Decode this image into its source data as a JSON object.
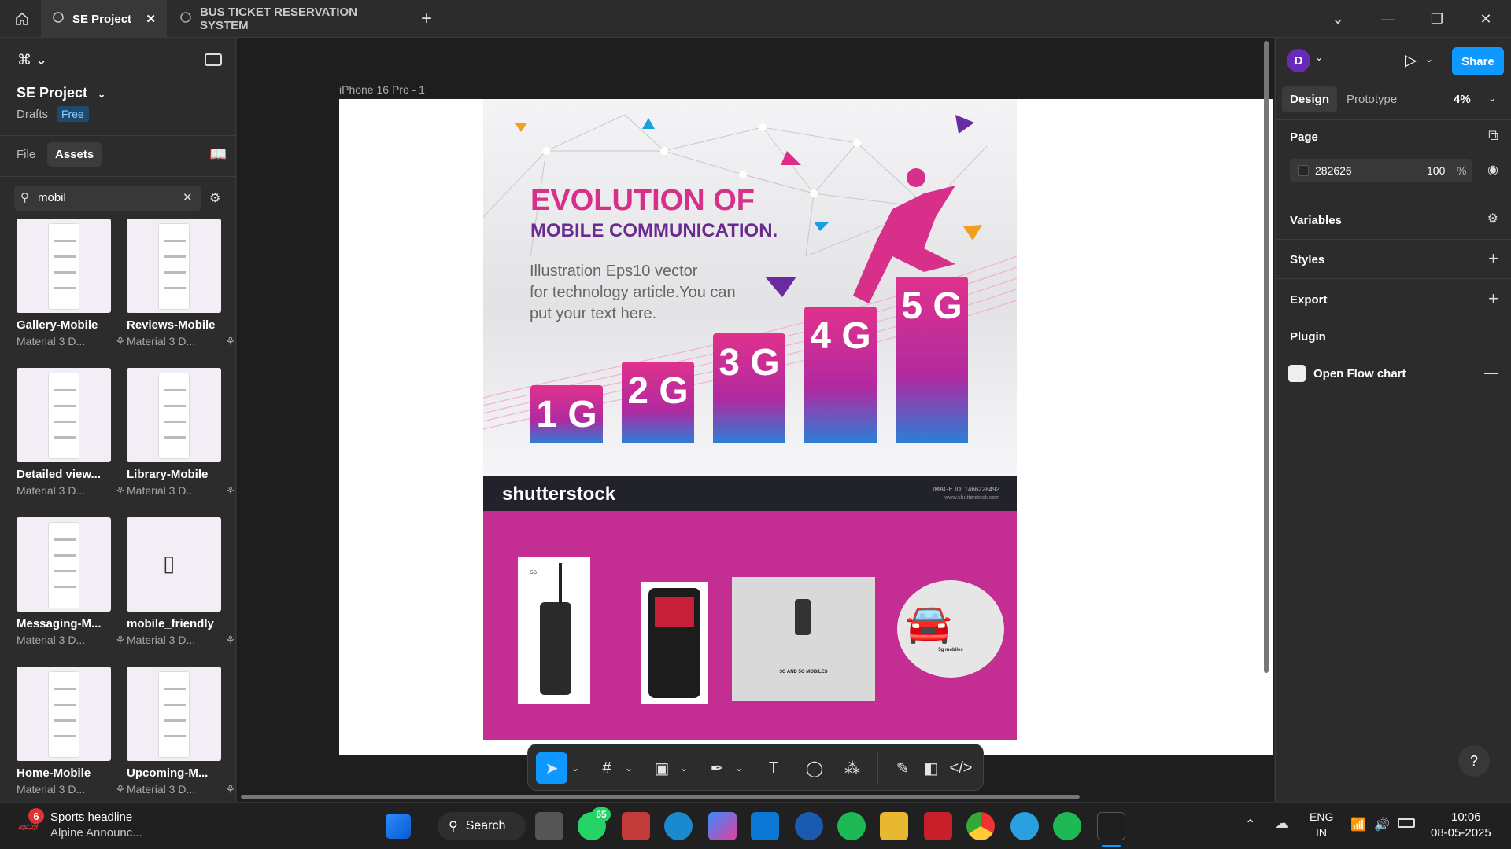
{
  "titlebar": {
    "tabs": [
      {
        "label": "SE Project",
        "active": true
      },
      {
        "label": "BUS TICKET RESERVATION SYSTEM",
        "active": false
      }
    ],
    "icons": [
      "home-icon",
      "figma-tab-icon",
      "close-icon",
      "add-tab-icon",
      "chevron-down-icon",
      "minimize-icon",
      "restore-icon",
      "close-window-icon"
    ]
  },
  "left": {
    "project_name": "SE Project",
    "drafts": "Drafts",
    "plan_badge": "Free",
    "tabs": {
      "file": "File",
      "assets": "Assets"
    },
    "search": {
      "value": "mobil",
      "placeholder": "Search"
    },
    "assets": [
      {
        "name": "Gallery-Mobile",
        "sub": "Material 3 D..."
      },
      {
        "name": "Reviews-Mobile",
        "sub": "Material 3 D..."
      },
      {
        "name": "Detailed view...",
        "sub": "Material 3 D..."
      },
      {
        "name": "Library-Mobile",
        "sub": "Material 3 D..."
      },
      {
        "name": "Messaging-M...",
        "sub": "Material 3 D..."
      },
      {
        "name": "mobile_friendly",
        "sub": "Material 3 D..."
      },
      {
        "name": "Home-Mobile",
        "sub": "Material 3 D..."
      },
      {
        "name": "Upcoming-M...",
        "sub": "Material 3 D..."
      }
    ]
  },
  "canvas": {
    "frame_label": "iPhone 16 Pro - 1",
    "poster": {
      "title1": "EVOLUTION OF",
      "title2": "MOBILE COMMUNICATION.",
      "body1": "Illustration Eps10 vector",
      "body2": "for technology article.You can",
      "body3": "put your text here.",
      "bars": [
        "1 G",
        "2 G",
        "3 G",
        "4 G",
        "5 G"
      ]
    },
    "shutterstock": {
      "logo": "shutterstock",
      "image_id": "IMAGE ID: 1466228492",
      "url": "www.shutterstock.com"
    },
    "cards": {
      "card1_label": "5G",
      "card3_label": "3G AND 5G MOBILES",
      "card4_label": "5g mobiles"
    }
  },
  "right": {
    "avatar": "D",
    "tabs": {
      "design": "Design",
      "prototype": "Prototype"
    },
    "zoom": "4%",
    "page_label": "Page",
    "page_color": "282626",
    "page_opacity": "100",
    "percent": "%",
    "variables": "Variables",
    "styles": "Styles",
    "export": "Export",
    "plugin": "Plugin",
    "plugin_item": "Open Flow chart",
    "share": "Share"
  },
  "taskbar": {
    "news_badge": "6",
    "news_title": "Sports headline",
    "news_sub": "Alpine Announc...",
    "search": "Search",
    "whatsapp_badge": "65",
    "lang1": "ENG",
    "lang2": "IN",
    "time": "10:06",
    "date": "08-05-2025"
  },
  "colors": {
    "accent": "#0d99ff",
    "magenta": "#c42d91",
    "panel": "#2c2c2c",
    "canvas": "#1e1e1e"
  }
}
